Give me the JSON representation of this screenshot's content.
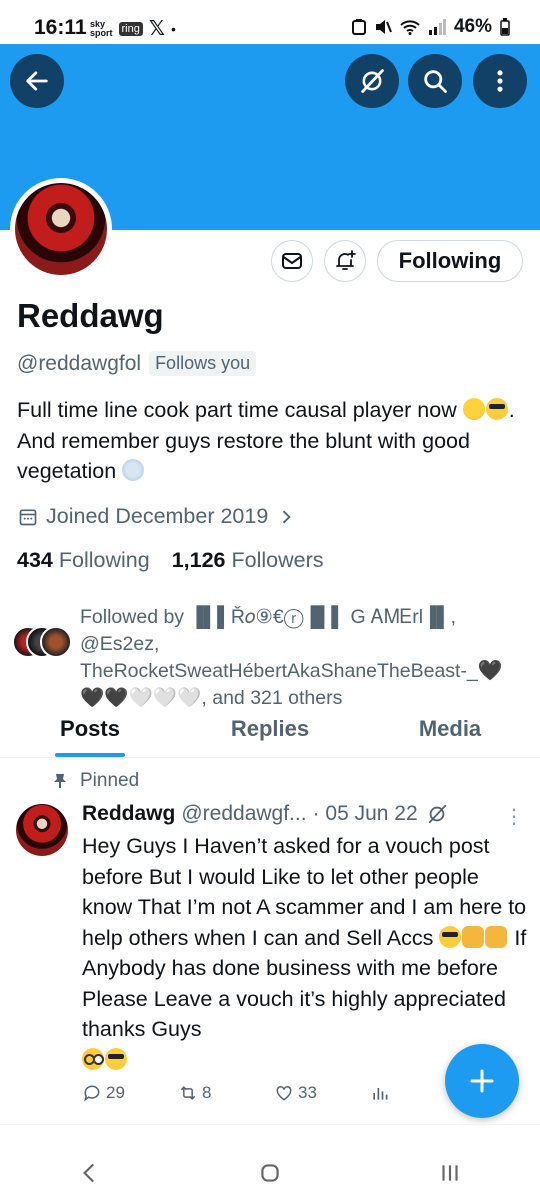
{
  "status_bar": {
    "time": "16:11",
    "left_icons": [
      "sky-sport-icon",
      "ring-icon",
      "x-icon",
      "dot"
    ],
    "sky": "sky\nsport",
    "ring": "ring",
    "x": "𝕏",
    "dot": "•",
    "battery": "46%"
  },
  "header": {
    "back_icon": "arrow-left-icon",
    "grok_icon": "grok-icon",
    "search_icon": "search-icon",
    "more_icon": "more-vertical-icon",
    "banner_color": "#1d9bf0"
  },
  "profile": {
    "name": "Reddawg",
    "handle": "@reddawgfol",
    "follows_you": "Follows you",
    "following_button": "Following",
    "bio_text_1": "Full time line cook part time causal player now",
    "bio_text_2": ". And remember guys restore the blunt with good vegetation",
    "joined": "Joined December 2019",
    "following_count": "434",
    "following_label": "Following",
    "followers_count": "1,126",
    "followers_label": "Followers",
    "followed_by_line1": "Followed by ▐▌▌Ř𝑜⑨€ⓡ▐▌▌ G ᎪᎷᎬrl▐▌, @Es2ez,",
    "followed_by_line2": "TheRocketSweatHébertAkaShaneTheBeast-_",
    "followed_by_hearts": "🖤🖤🤍🤍🤍",
    "followed_by_others": ", and 321 others"
  },
  "tabs": [
    {
      "label": "Posts",
      "active": true
    },
    {
      "label": "Replies",
      "active": false
    },
    {
      "label": "Media",
      "active": false
    }
  ],
  "tweet": {
    "pinned_label": "Pinned",
    "name": "Reddawg",
    "handle": "@reddawgf...",
    "date": "· 05 Jun 22",
    "body_1": "Hey Guys I Haven’t asked for a vouch post before But I would Like to let other people know That I’m not A scammer and I am here to help others when I can and Sell Accs",
    "body_2": " If Anybody has done business with me before Please Leave a vouch it’s highly appreciated thanks Guys",
    "replies": "29",
    "reposts": "8",
    "likes": "33"
  },
  "colors": {
    "accent": "#1d9bf0",
    "text": "#0f1419",
    "secondary": "#536471"
  }
}
